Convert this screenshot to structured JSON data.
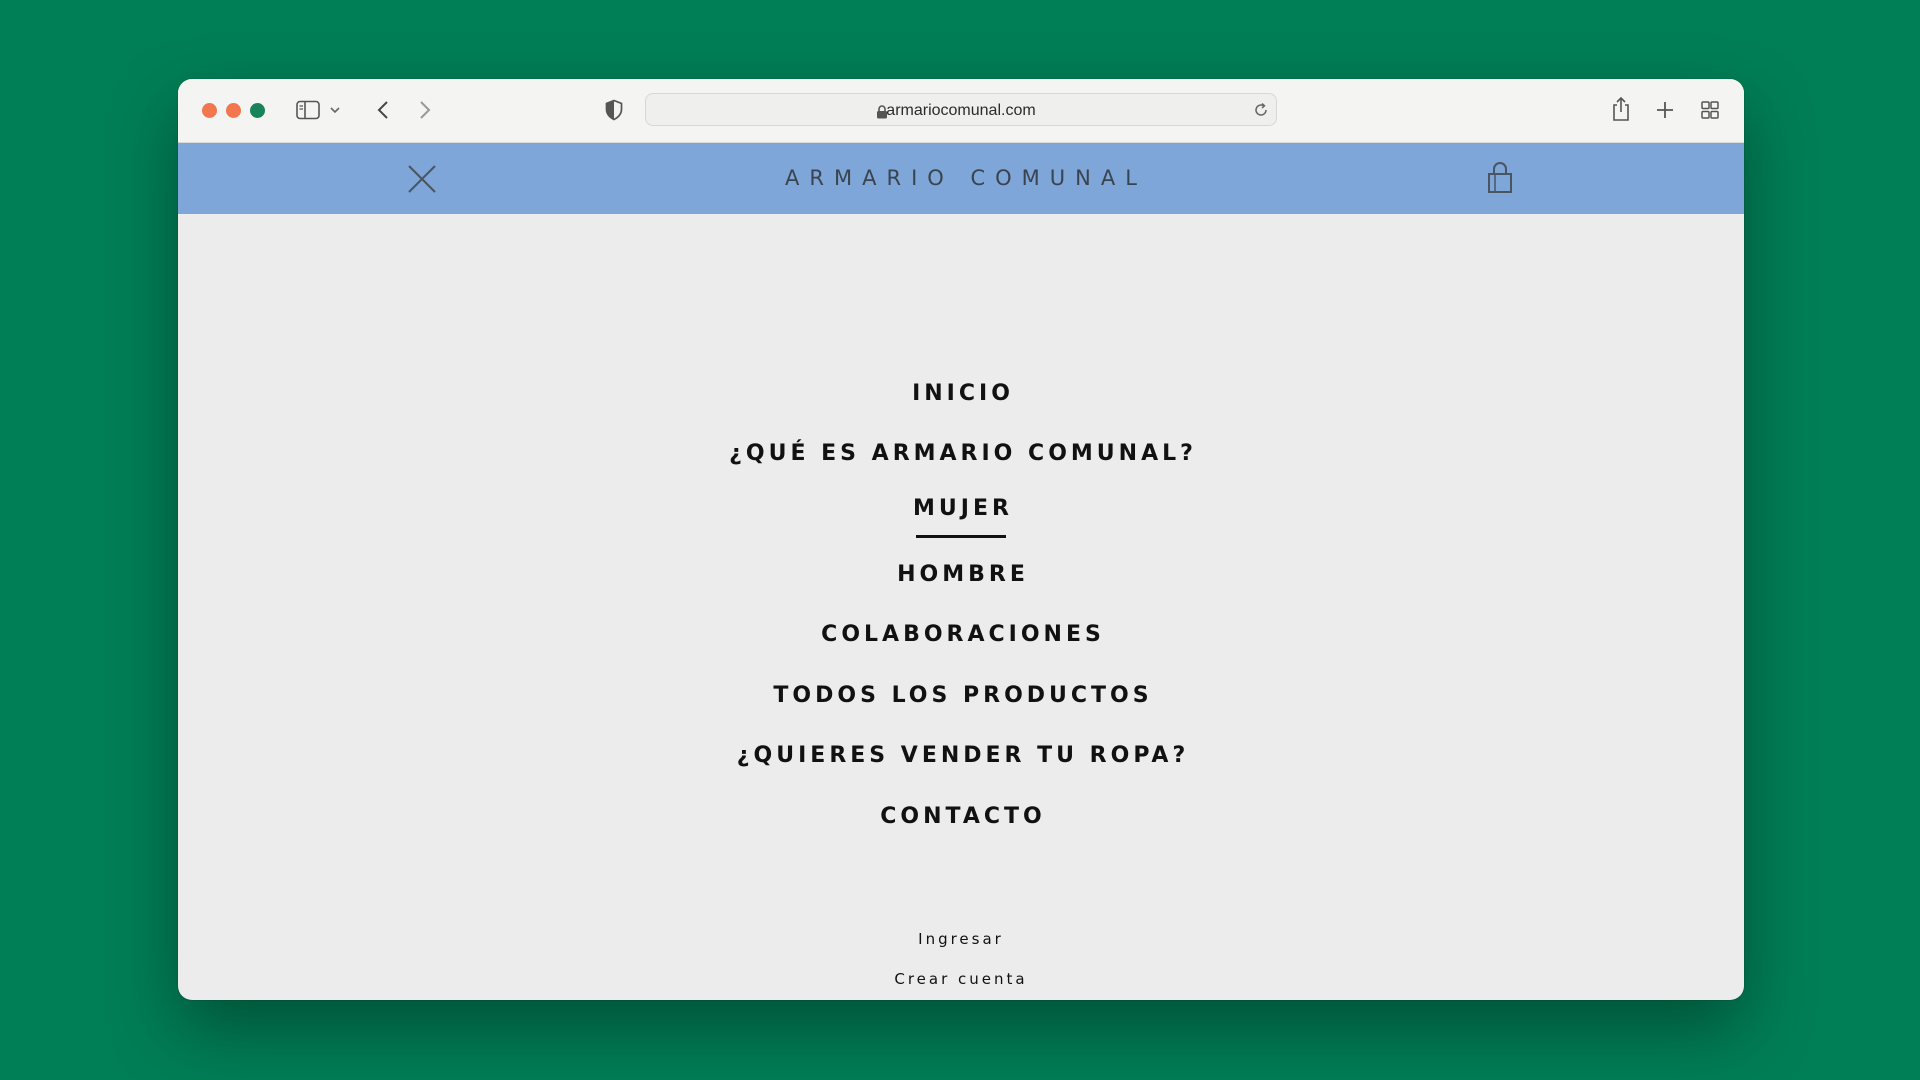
{
  "browser": {
    "url": "armariocomunal.com",
    "icons": {
      "sidebar": "sidebar-icon",
      "chevron": "chevron-down-icon",
      "back": "back-arrow-icon",
      "forward": "forward-arrow-icon",
      "privacy": "shield-icon",
      "lock": "lock-icon",
      "reload": "reload-icon",
      "share": "share-icon",
      "new_tab": "plus-icon",
      "tab_overview": "grid-icon"
    },
    "colors": {
      "close": "#f2774f",
      "minimize": "#f2774f",
      "zoom": "#17845a"
    }
  },
  "site": {
    "logo": "ARMARIO COMUNAL",
    "header_color": "#7ea6d8",
    "icons": {
      "close": "close-icon",
      "cart": "shopping-bag-icon"
    }
  },
  "menu": {
    "items": [
      {
        "label": "INICIO"
      },
      {
        "label": "¿QUÉ ES ARMARIO COMUNAL?"
      },
      {
        "label": "MUJER",
        "active": true
      },
      {
        "label": "HOMBRE"
      },
      {
        "label": "COLABORACIONES"
      },
      {
        "label": "TODOS LOS PRODUCTOS"
      },
      {
        "label": "¿QUIERES VENDER TU ROPA?"
      },
      {
        "label": "CONTACTO"
      }
    ]
  },
  "account": {
    "login": "Ingresar",
    "create_account": "Crear cuenta"
  }
}
